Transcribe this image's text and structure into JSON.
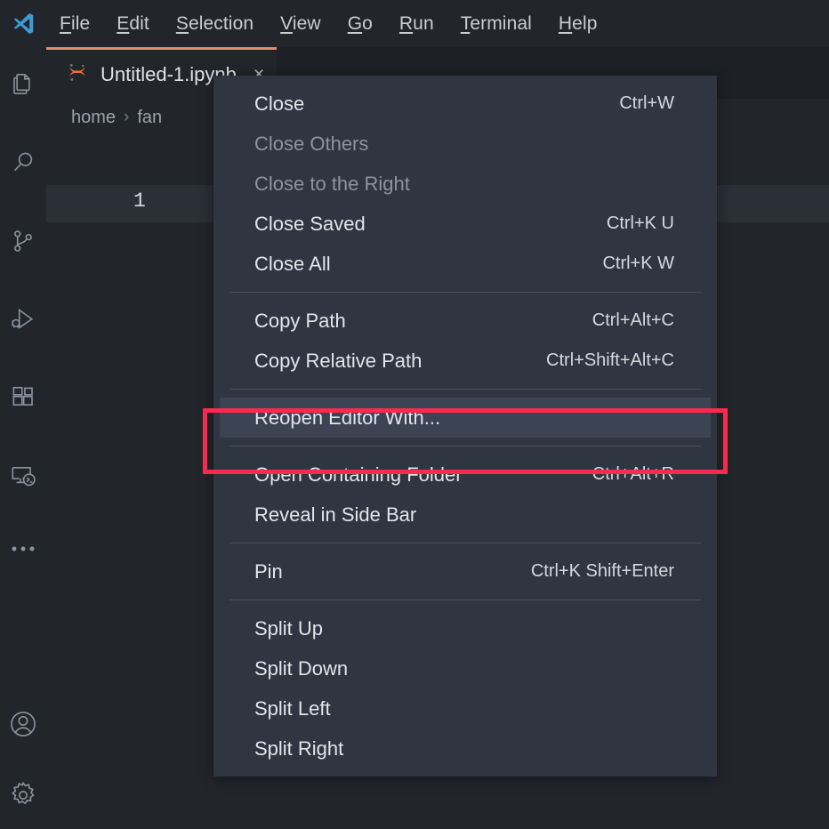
{
  "app": {
    "name": "Visual Studio Code",
    "logo_icon": "vscode-logo-icon",
    "background_color": "#22262b",
    "menu_background_color": "#2f3541",
    "accent_color": "#e98974",
    "annotation_color": "#f72b50"
  },
  "menubar": {
    "items": [
      {
        "label": "File",
        "accel": "F"
      },
      {
        "label": "Edit",
        "accel": "E"
      },
      {
        "label": "Selection",
        "accel": "S"
      },
      {
        "label": "View",
        "accel": "V"
      },
      {
        "label": "Go",
        "accel": "G"
      },
      {
        "label": "Run",
        "accel": "R"
      },
      {
        "label": "Terminal",
        "accel": "T"
      },
      {
        "label": "Help",
        "accel": "H"
      }
    ]
  },
  "activitybar": {
    "items": [
      {
        "name": "explorer",
        "icon": "files-icon"
      },
      {
        "name": "search",
        "icon": "search-icon"
      },
      {
        "name": "source-control",
        "icon": "source-control-icon"
      },
      {
        "name": "run-and-debug",
        "icon": "run-debug-icon"
      },
      {
        "name": "extensions",
        "icon": "extensions-icon"
      },
      {
        "name": "remote-explorer",
        "icon": "remote-explorer-icon"
      },
      {
        "name": "additional-views",
        "icon": "ellipsis-icon"
      }
    ],
    "bottom_items": [
      {
        "name": "accounts",
        "icon": "account-icon"
      },
      {
        "name": "manage-settings",
        "icon": "gear-icon"
      }
    ]
  },
  "editor": {
    "tab": {
      "title": "Untitled-1.ipynb",
      "icon": "jupyter-notebook-icon",
      "close_glyph": "×",
      "active": true
    },
    "breadcrumb": {
      "parts": [
        "home",
        "fan"
      ],
      "separator": "›"
    },
    "notebook": {
      "line_number": "1"
    }
  },
  "context_menu": {
    "groups": [
      {
        "items": [
          {
            "label": "Close",
            "shortcut": "Ctrl+W",
            "disabled": false,
            "highlighted": false
          },
          {
            "label": "Close Others",
            "shortcut": "",
            "disabled": true,
            "highlighted": false
          },
          {
            "label": "Close to the Right",
            "shortcut": "",
            "disabled": true,
            "highlighted": false
          },
          {
            "label": "Close Saved",
            "shortcut": "Ctrl+K U",
            "disabled": false,
            "highlighted": false
          },
          {
            "label": "Close All",
            "shortcut": "Ctrl+K W",
            "disabled": false,
            "highlighted": false
          }
        ]
      },
      {
        "items": [
          {
            "label": "Copy Path",
            "shortcut": "Ctrl+Alt+C",
            "disabled": false,
            "highlighted": false
          },
          {
            "label": "Copy Relative Path",
            "shortcut": "Ctrl+Shift+Alt+C",
            "disabled": false,
            "highlighted": false
          }
        ]
      },
      {
        "items": [
          {
            "label": "Reopen Editor With...",
            "shortcut": "",
            "disabled": false,
            "highlighted": true
          }
        ]
      },
      {
        "items": [
          {
            "label": "Open Containing Folder",
            "shortcut": "Ctrl+Alt+R",
            "disabled": false,
            "highlighted": false
          },
          {
            "label": "Reveal in Side Bar",
            "shortcut": "",
            "disabled": false,
            "highlighted": false
          }
        ]
      },
      {
        "items": [
          {
            "label": "Pin",
            "shortcut": "Ctrl+K Shift+Enter",
            "disabled": false,
            "highlighted": false
          }
        ]
      },
      {
        "items": [
          {
            "label": "Split Up",
            "shortcut": "",
            "disabled": false,
            "highlighted": false
          },
          {
            "label": "Split Down",
            "shortcut": "",
            "disabled": false,
            "highlighted": false
          },
          {
            "label": "Split Left",
            "shortcut": "",
            "disabled": false,
            "highlighted": false
          },
          {
            "label": "Split Right",
            "shortcut": "",
            "disabled": false,
            "highlighted": false
          }
        ]
      }
    ]
  },
  "annotation": {
    "target_label": "Reopen Editor With...",
    "shape": "rectangle",
    "color": "#f72b50"
  }
}
